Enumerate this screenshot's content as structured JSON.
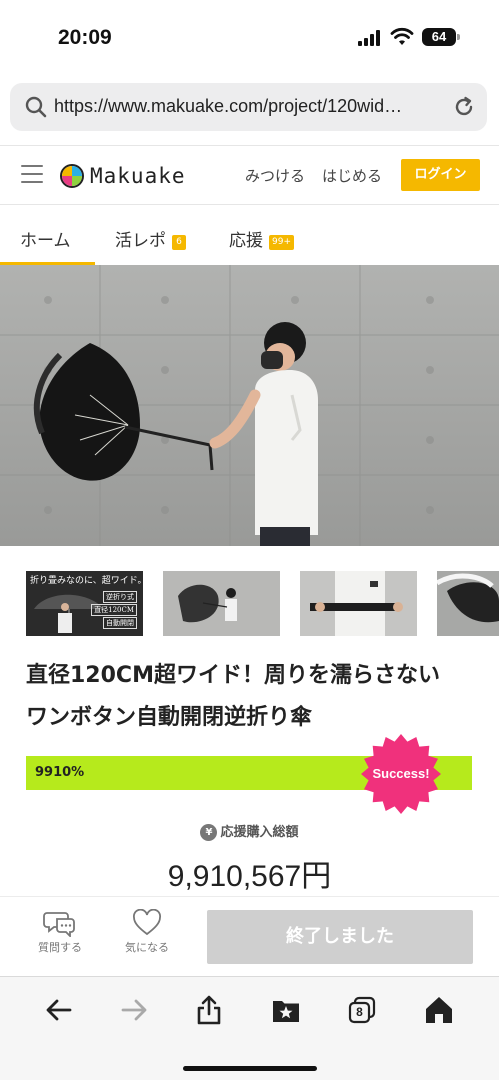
{
  "status_bar": {
    "time": "20:09",
    "battery": "64"
  },
  "browser": {
    "url": "https://www.makuake.com/project/120wid…"
  },
  "header": {
    "logo_text": "Makuake",
    "nav": [
      {
        "label": "みつける"
      },
      {
        "label": "はじめる"
      }
    ],
    "login_label": "ログイン"
  },
  "tabs": [
    {
      "label": "ホーム",
      "badge": "",
      "active": true
    },
    {
      "label": "活レポ",
      "badge": "6",
      "active": false
    },
    {
      "label": "応援",
      "badge": "99+",
      "active": false
    }
  ],
  "thumbnails": [
    {
      "caption": "折り畳みなのに、超ワイド。",
      "tags": [
        "逆折り式",
        "直径120CM",
        "自動開閉"
      ]
    },
    {
      "caption": ""
    },
    {
      "caption": ""
    },
    {
      "caption": ""
    }
  ],
  "project": {
    "title_line1": "直径120CM超ワイド！周りを濡らさない",
    "title_line2": "ワンボタン自動開閉逆折り傘"
  },
  "progress": {
    "label": "9910%",
    "fill_fraction": 1.0,
    "badge": "Success!"
  },
  "funding": {
    "label": "応援購入総額",
    "yen_symbol": "¥",
    "amount": "9,910,567円"
  },
  "actions": {
    "question_label": "質問する",
    "favorite_label": "気になる",
    "ended_label": "終了しました"
  },
  "toolbar": {
    "tab_count": "8"
  },
  "colors": {
    "brand_yellow": "#f5b800",
    "progress_green": "#b6ea1c",
    "success_pink": "#f0317c"
  }
}
